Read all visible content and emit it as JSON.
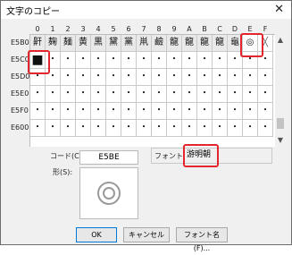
{
  "window": {
    "title": "文字のコピー",
    "close_glyph": "✕"
  },
  "grid": {
    "column_headers": [
      "0",
      "1",
      "2",
      "3",
      "4",
      "5",
      "6",
      "7",
      "8",
      "9",
      "A",
      "B",
      "C",
      "D",
      "E",
      "F"
    ],
    "row_labels": [
      "E5B0",
      "E5C0",
      "E5D0",
      "E5E0",
      "E5F0",
      "E600"
    ],
    "first_row": [
      "鼾",
      "麹",
      "麺",
      "黄",
      "黒",
      "黛",
      "黨",
      "鼡",
      "鹼",
      "龍",
      "龍",
      "龍",
      "龍",
      "龜",
      "◎",
      "╳"
    ],
    "empty_glyph": "・",
    "selected_glyph": "■"
  },
  "details": {
    "code_label": "コード(C):",
    "code_value": "E5BE",
    "font_label": "フォント:",
    "font_value": "游明朝",
    "shape_label": "形(S):"
  },
  "buttons": {
    "ok": "OK",
    "cancel": "キャンセル",
    "font_name": "フォント名(F)..."
  },
  "colors": {
    "highlight": "#e2262b",
    "selection_gray": "#e9e9e9",
    "accent": "#0078d7"
  }
}
